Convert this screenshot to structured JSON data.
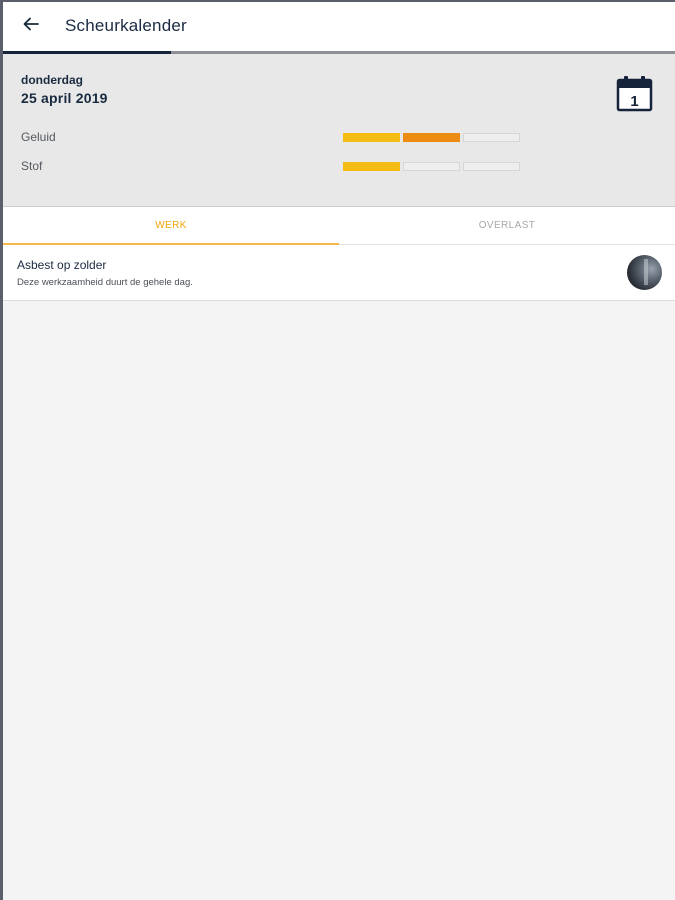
{
  "appbar": {
    "title": "Scheurkalender",
    "back_icon": "arrow-left-icon",
    "progress_fraction": 0.25
  },
  "day": {
    "weekday": "donderdag",
    "date": "25 april 2019",
    "calendar_icon": "calendar-icon",
    "calendar_number": "1"
  },
  "meters": [
    {
      "label": "Geluid",
      "levels": [
        "#f5bd13",
        "#ec8c12",
        null
      ]
    },
    {
      "label": "Stof",
      "levels": [
        "#f5bd13",
        null,
        null
      ]
    }
  ],
  "tabs": {
    "active": "WERK",
    "items": [
      {
        "label": "WERK"
      },
      {
        "label": "OVERLAST"
      }
    ]
  },
  "items": [
    {
      "title": "Asbest op zolder",
      "subtitle": "Deze werkzaamheid duurt de gehele dag."
    }
  ],
  "colors": {
    "accent": "#f0a30a",
    "navy": "#15243a",
    "level_low": "#f5bd13",
    "level_mid": "#ec8c12"
  }
}
